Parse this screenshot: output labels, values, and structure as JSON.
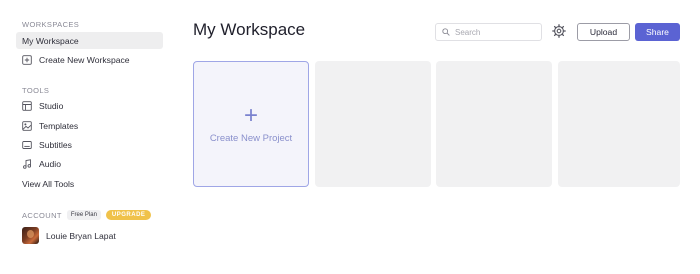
{
  "sidebar": {
    "workspaces_title": "WORKSPACES",
    "workspaces": [
      {
        "label": "My Workspace",
        "active": true
      },
      {
        "label": "Create New Workspace",
        "icon": "plus-square-icon"
      }
    ],
    "tools_title": "TOOLS",
    "tools": [
      {
        "label": "Studio",
        "icon": "studio-icon"
      },
      {
        "label": "Templates",
        "icon": "image-icon"
      },
      {
        "label": "Subtitles",
        "icon": "subtitles-icon"
      },
      {
        "label": "Audio",
        "icon": "music-note-icon"
      }
    ],
    "view_all": "View All Tools",
    "account_title": "ACCOUNT",
    "plan_badge": "Free Plan",
    "upgrade_label": "UPGRADE",
    "user_name": "Louie Bryan Lapat"
  },
  "header": {
    "title": "My Workspace",
    "search_placeholder": "Search",
    "upload_label": "Upload",
    "share_label": "Share"
  },
  "main": {
    "new_project_symbol": "+",
    "new_project_label": "Create New Project"
  },
  "colors": {
    "accent": "#5b63d3",
    "upgrade": "#f0c24a",
    "card_placeholder": "#f1f1f2"
  }
}
